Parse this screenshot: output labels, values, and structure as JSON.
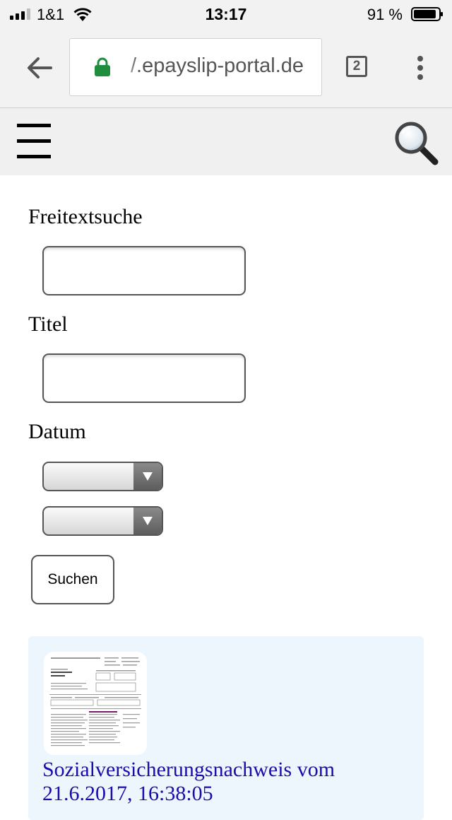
{
  "status_bar": {
    "carrier": "1&1",
    "time": "13:17",
    "battery_percent": "91 %",
    "battery_level": 0.91
  },
  "browser": {
    "url_display": "/.epayslip-portal.de",
    "tab_count": "2",
    "secure_color": "#1e8e3e"
  },
  "site_header": {
    "menu_icon": "hamburger-menu-icon",
    "search_icon": "magnifier-icon"
  },
  "form": {
    "freitext_label": "Freitextsuche",
    "freitext_value": "",
    "titel_label": "Titel",
    "titel_value": "",
    "datum_label": "Datum",
    "date_from_value": "",
    "date_to_value": "",
    "submit_label": "Suchen"
  },
  "results": [
    {
      "title": "Sozialversicherungsnachweis vom 21.6.2017, 16:38:05",
      "link_color": "#1a0dab"
    }
  ]
}
